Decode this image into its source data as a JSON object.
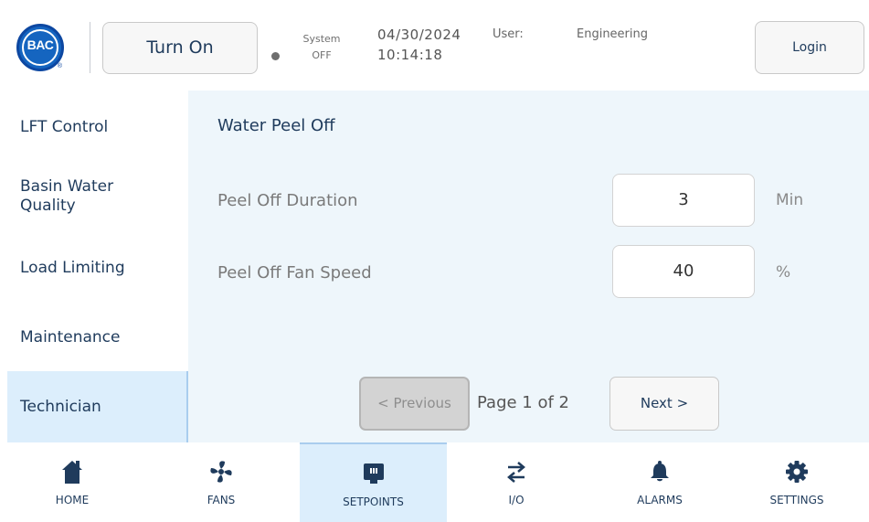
{
  "header": {
    "logo_text": "BAC",
    "turn_on_label": "Turn On",
    "system_label": "System",
    "system_status": "OFF",
    "date": "04/30/2024",
    "time": "10:14:18",
    "user_label": "User:",
    "user_value": "Engineering",
    "login_label": "Login"
  },
  "sidebar": {
    "items": [
      {
        "label": "LFT Control"
      },
      {
        "label": "Basin Water Quality"
      },
      {
        "label": "Load Limiting"
      },
      {
        "label": "Maintenance"
      },
      {
        "label": "Technician",
        "active": true
      }
    ]
  },
  "main": {
    "title": "Water Peel Off",
    "params": [
      {
        "label": "Peel Off Duration",
        "value": "3",
        "unit": "Min"
      },
      {
        "label": "Peel Off Fan Speed",
        "value": "40",
        "unit": "%"
      }
    ],
    "pager": {
      "prev_label": "< Previous",
      "page_text": "Page 1 of 2",
      "next_label": "Next >"
    }
  },
  "nav": {
    "items": [
      {
        "label": "HOME",
        "icon": "home-icon"
      },
      {
        "label": "FANS",
        "icon": "fan-icon"
      },
      {
        "label": "SETPOINTS",
        "icon": "setpoints-icon",
        "active": true
      },
      {
        "label": "I/O",
        "icon": "io-arrows-icon"
      },
      {
        "label": "ALARMS",
        "icon": "bell-icon"
      },
      {
        "label": "SETTINGS",
        "icon": "gear-icon"
      }
    ]
  },
  "colors": {
    "accent": "#1f3b5c",
    "panel_bg": "#eef6fb",
    "active_bg": "#dceefc",
    "logo_blue": "#1565c0"
  }
}
